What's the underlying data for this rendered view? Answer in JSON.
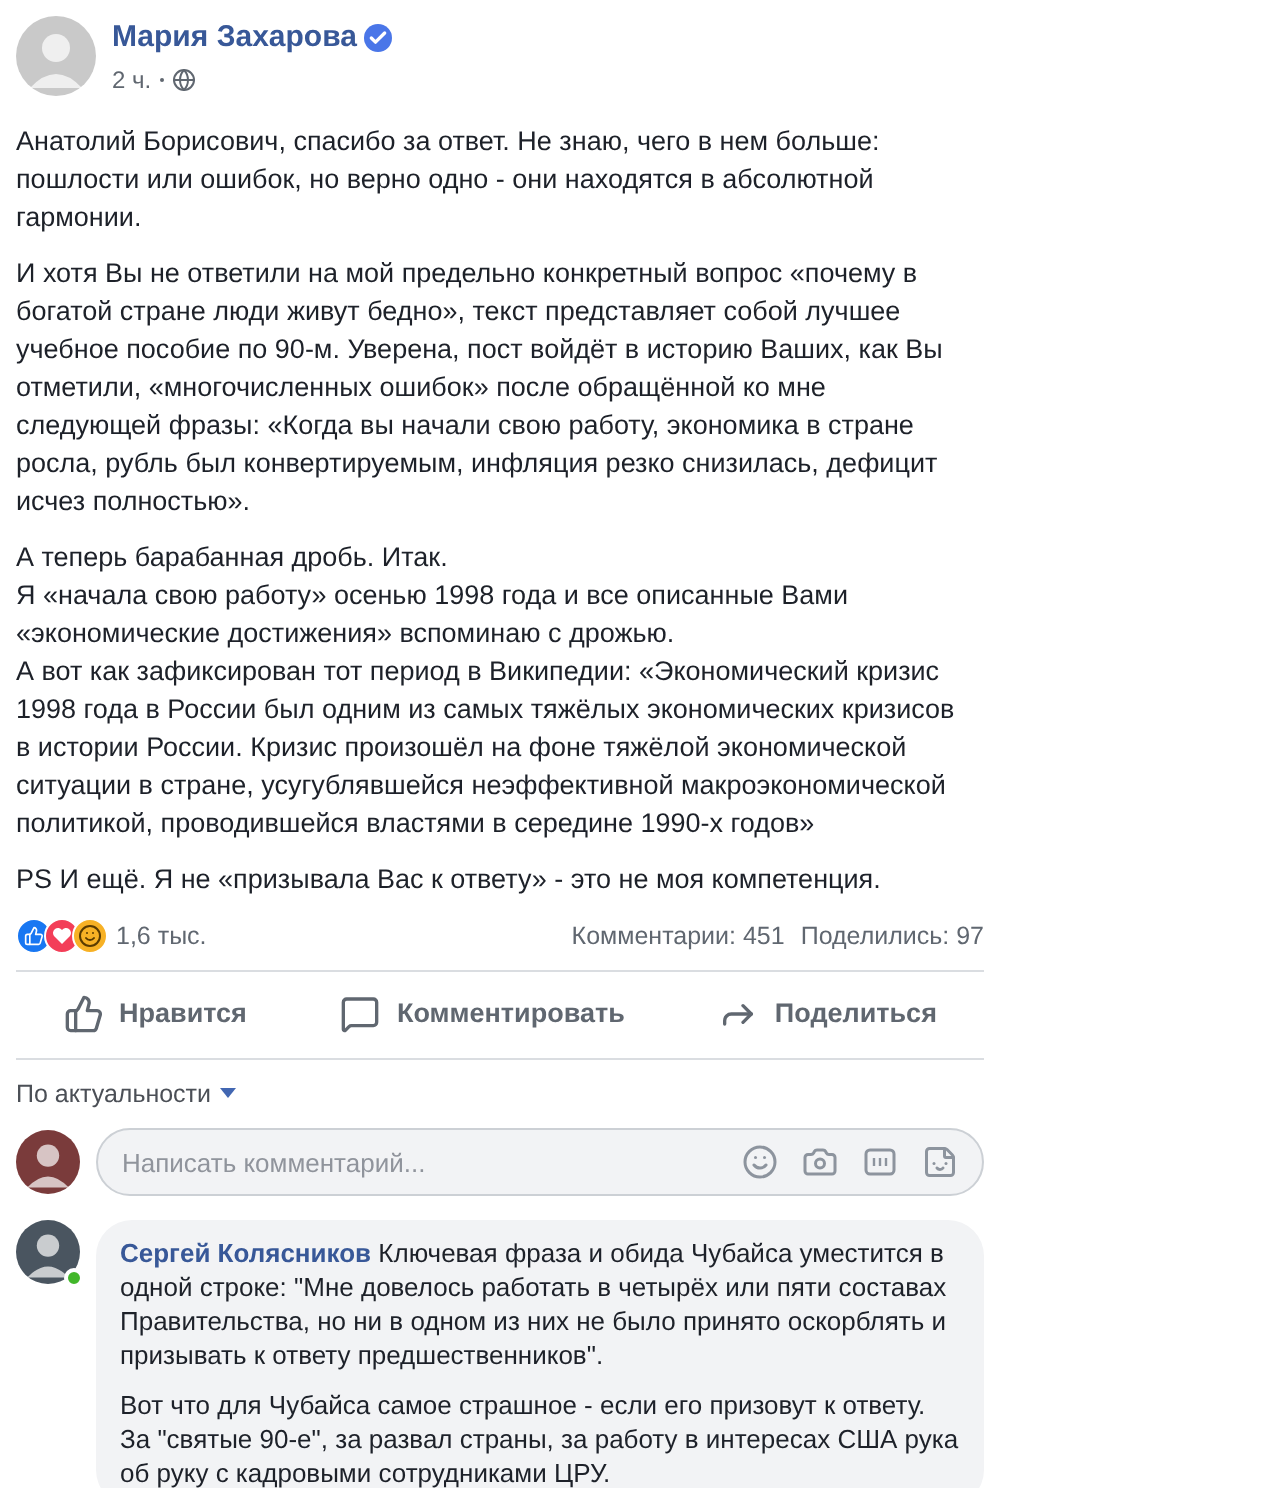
{
  "post": {
    "author": "Мария Захарова",
    "verified": true,
    "time": "2 ч.",
    "paragraphs": [
      [
        "Анатолий Борисович, спасибо за ответ. Не знаю, чего в нем больше: пошлости или ошибок, но верно одно - они находятся в абсолютной гармонии."
      ],
      [
        "И хотя Вы не ответили на мой предельно конкретный вопрос «почему в богатой стране люди живут бедно», текст представляет собой лучшее учебное пособие по 90-м. Уверена, пост войдёт в историю Ваших, как Вы отметили, «многочисленных ошибок» после обращённой ко мне следующей фразы: «Когда вы начали свою работу, экономика в стране росла, рубль был конвертируемым, инфляция резко снизилась, дефицит исчез полностью»."
      ],
      [
        "А теперь барабанная дробь. Итак.",
        "Я «начала свою работу» осенью 1998 года и все описанные Вами «экономические достижения» вспоминаю с дрожью.",
        "А вот как зафиксирован тот период в Википедии: «Экономический кризис 1998 года в России был одним из самых тяжёлых экономических кризисов в истории России. Кризис произошёл на фоне тяжёлой экономической ситуации в стране, усугублявшейся неэффективной макроэкономической политикой, проводившейся властями в середине 1990-х годов»"
      ],
      [
        "PS И ещё. Я не «призывала Вас к ответу» - это не моя компетенция."
      ]
    ]
  },
  "reactions": {
    "count": "1,6 тыс.",
    "comments": "Комментарии: 451",
    "shares": "Поделились: 97"
  },
  "actions": [
    {
      "kind": "like",
      "label": "Нравится"
    },
    {
      "kind": "comment",
      "label": "Комментировать"
    },
    {
      "kind": "share",
      "label": "Поделиться"
    }
  ],
  "sort": "По актуальности",
  "composer": {
    "placeholder": "Написать комментарий..."
  },
  "comments": [
    {
      "author": "Сергей Колясников",
      "online": true,
      "paragraphs": [
        "Ключевая фраза и обида Чубайса уместится в одной строке: \"Мне довелось работать в четырёх или пяти составах Правительства, но ни в одном из них не было принято оскорблять и призывать к ответу предшественников\".",
        "Вот что для Чубайса самое страшное - если его призовут к ответу. За \"святые 90-е\", за развал страны, за работу в интересах США рука об руку с кадровыми сотрудниками ЦРУ."
      ]
    }
  ]
}
